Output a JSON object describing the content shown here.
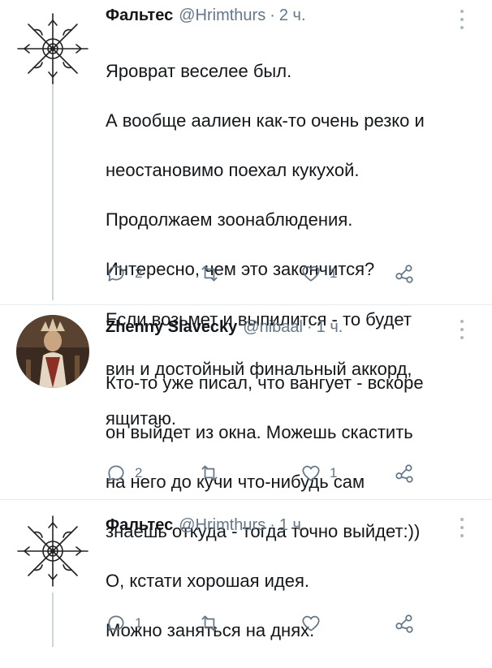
{
  "tweets": [
    {
      "name": "Фальтес",
      "handle": "@Hrimthurs",
      "separator": "·",
      "time": "2 ч.",
      "lines": [
        "Яроврат веселее был.",
        "А вообще аалиен как-то очень резко и",
        "неостановимо поехал кукухой.",
        "Продолжаем зоонаблюдения.",
        "Интересно, чем это закончится?",
        "Если возьмет и выпилится - то будет",
        "вин и достойный финальный аккорд,",
        "ящитаю."
      ],
      "reply_count": "2",
      "retweet_count": "",
      "like_count": "1"
    },
    {
      "name": "Zhenny Slavecky",
      "handle": "@nibaal",
      "separator": "·",
      "time": "1 ч.",
      "lines": [
        "Кто-то уже писал, что вангует - вскоре",
        "он выйдет из окна. Можешь скастить",
        "на него до кучи что-нибудь сам",
        "знаешь откуда - тогда точно выйдет:))"
      ],
      "reply_count": "2",
      "retweet_count": "",
      "like_count": "1"
    },
    {
      "name": "Фальтес",
      "handle": "@Hrimthurs",
      "separator": "·",
      "time": "1 ч.",
      "lines": [
        "О, кстати хорошая идея.",
        "Можно заняться на днях."
      ],
      "reply_count": "1",
      "retweet_count": "",
      "like_count": ""
    }
  ],
  "colors": {
    "text": "#14171a",
    "secondary": "#657786",
    "thread_line": "#ccd6dd",
    "icon": "#657786"
  },
  "icons": [
    "reply-icon",
    "retweet-icon",
    "like-icon",
    "share-icon",
    "more-icon",
    "avatar-runic-symbol",
    "avatar-portrait"
  ]
}
